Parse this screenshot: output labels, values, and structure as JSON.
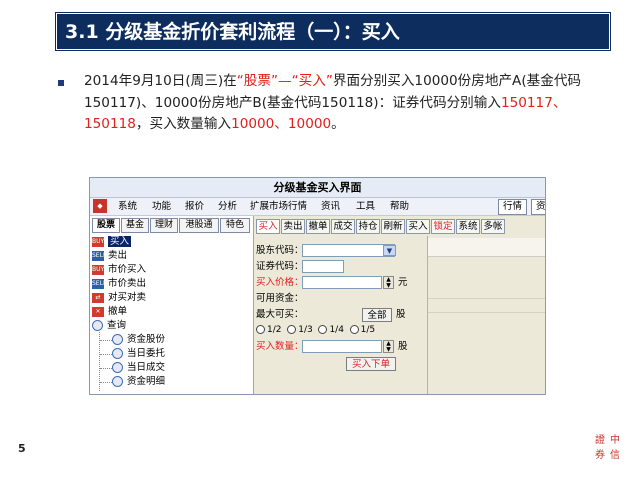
{
  "slide": {
    "title": "3.1 分级基金折价套利流程（一）：买入",
    "page_number": "5",
    "bullet": {
      "p1": "2014年9月10日(周三)在",
      "p2": "“股票”—“买入”",
      "p3": "界面分别买入10000份房地产A(基金代码150117)、10000份房地产B(基金代码150118)：证券代码分别输入",
      "p4": "150117、150118",
      "p5": "，买入数量输入",
      "p6": "10000、10000",
      "p7": "。"
    },
    "logo_chars": [
      "證",
      "中",
      "券",
      "信"
    ]
  },
  "app": {
    "window_title": "分级基金买入界面",
    "logo_icon": "broker-logo-icon",
    "menu": [
      "系统",
      "功能",
      "报价",
      "分析",
      "扩展市场行情",
      "资讯",
      "工具",
      "帮助"
    ],
    "right_buttons": [
      "行情",
      "资"
    ],
    "left_tabs": [
      "股票",
      "基金",
      "理财",
      "港股通",
      "特色"
    ],
    "tree": [
      {
        "label": "买入",
        "icon": "buy-icon",
        "selected": true
      },
      {
        "label": "卖出",
        "icon": "sell-icon"
      },
      {
        "label": "市价买入",
        "icon": "market-buy-icon"
      },
      {
        "label": "市价卖出",
        "icon": "market-sell-icon"
      },
      {
        "label": "对买对卖",
        "icon": "cross-trade-icon"
      },
      {
        "label": "撤单",
        "icon": "cancel-order-icon"
      },
      {
        "label": "查询",
        "icon": "query-icon"
      },
      {
        "label": "资金股份",
        "icon": "query-sub-icon"
      },
      {
        "label": "当日委托",
        "icon": "query-sub-icon"
      },
      {
        "label": "当日成交",
        "icon": "query-sub-icon"
      },
      {
        "label": "资金明细",
        "icon": "query-sub-icon"
      }
    ],
    "form_tabs": [
      "买入",
      "卖出",
      "撤单",
      "成交",
      "持仓",
      "刷新",
      "买入",
      "锁定",
      "系统",
      "多帐"
    ],
    "form": {
      "account_label": "股东代码：",
      "account_value": "",
      "code_label": "证券代码：",
      "code_value": "",
      "price_label": "买入价格：",
      "price_value": "",
      "price_unit": "元",
      "funds_label": "可用资金：",
      "max_label": "最大可买：",
      "all_button": "全部",
      "all_unit": "股",
      "ratios": [
        "1/2",
        "1/3",
        "1/4",
        "1/5"
      ],
      "qty_label": "买入数量：",
      "qty_value": "",
      "qty_unit": "股",
      "submit": "买入下单"
    }
  }
}
